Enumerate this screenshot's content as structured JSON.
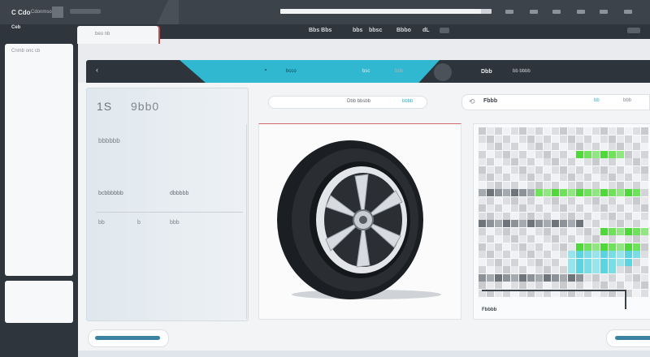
{
  "topbar": {
    "brand": "C Cdo",
    "brand_sub": "Cdonmson",
    "progress": 0.95
  },
  "subbar": {
    "items": [
      "Bbs Bbs",
      "bbs",
      "bbsc",
      "Bbbo",
      "dL"
    ]
  },
  "sidebar": {
    "label": "Ceb",
    "card_text": "Cnmb onc cb"
  },
  "tab_card": {
    "label": "beo nb"
  },
  "header": {
    "back_icon": "‹",
    "cyan_icon": "◔",
    "cyan_label": "bcco",
    "label_1": "bsc",
    "label_2": "bbb",
    "label_3": "Dbb",
    "label_4": "bb bbbb"
  },
  "left_panel": {
    "big_1": "1S",
    "big_2": "9bb0",
    "sub_1": "bbbbbb",
    "sub_2": "bcbbbbbb",
    "sub_3": "dbbbbb",
    "sub_4": "bb",
    "sub_5": "b",
    "sub_6": "bbb"
  },
  "center": {
    "search_label": "Dbb bbsbb",
    "search_action": "bbbb",
    "image": "wheel-tire"
  },
  "right": {
    "title": "Fbbb",
    "link_1": "bb",
    "link_2": "bbb",
    "footer": "Fbbbb"
  },
  "colors": {
    "dark": "#2f353c",
    "accent_cyan": "#2fb8cf",
    "accent_green": "#58d83f",
    "accent_red": "#c64a4a"
  }
}
